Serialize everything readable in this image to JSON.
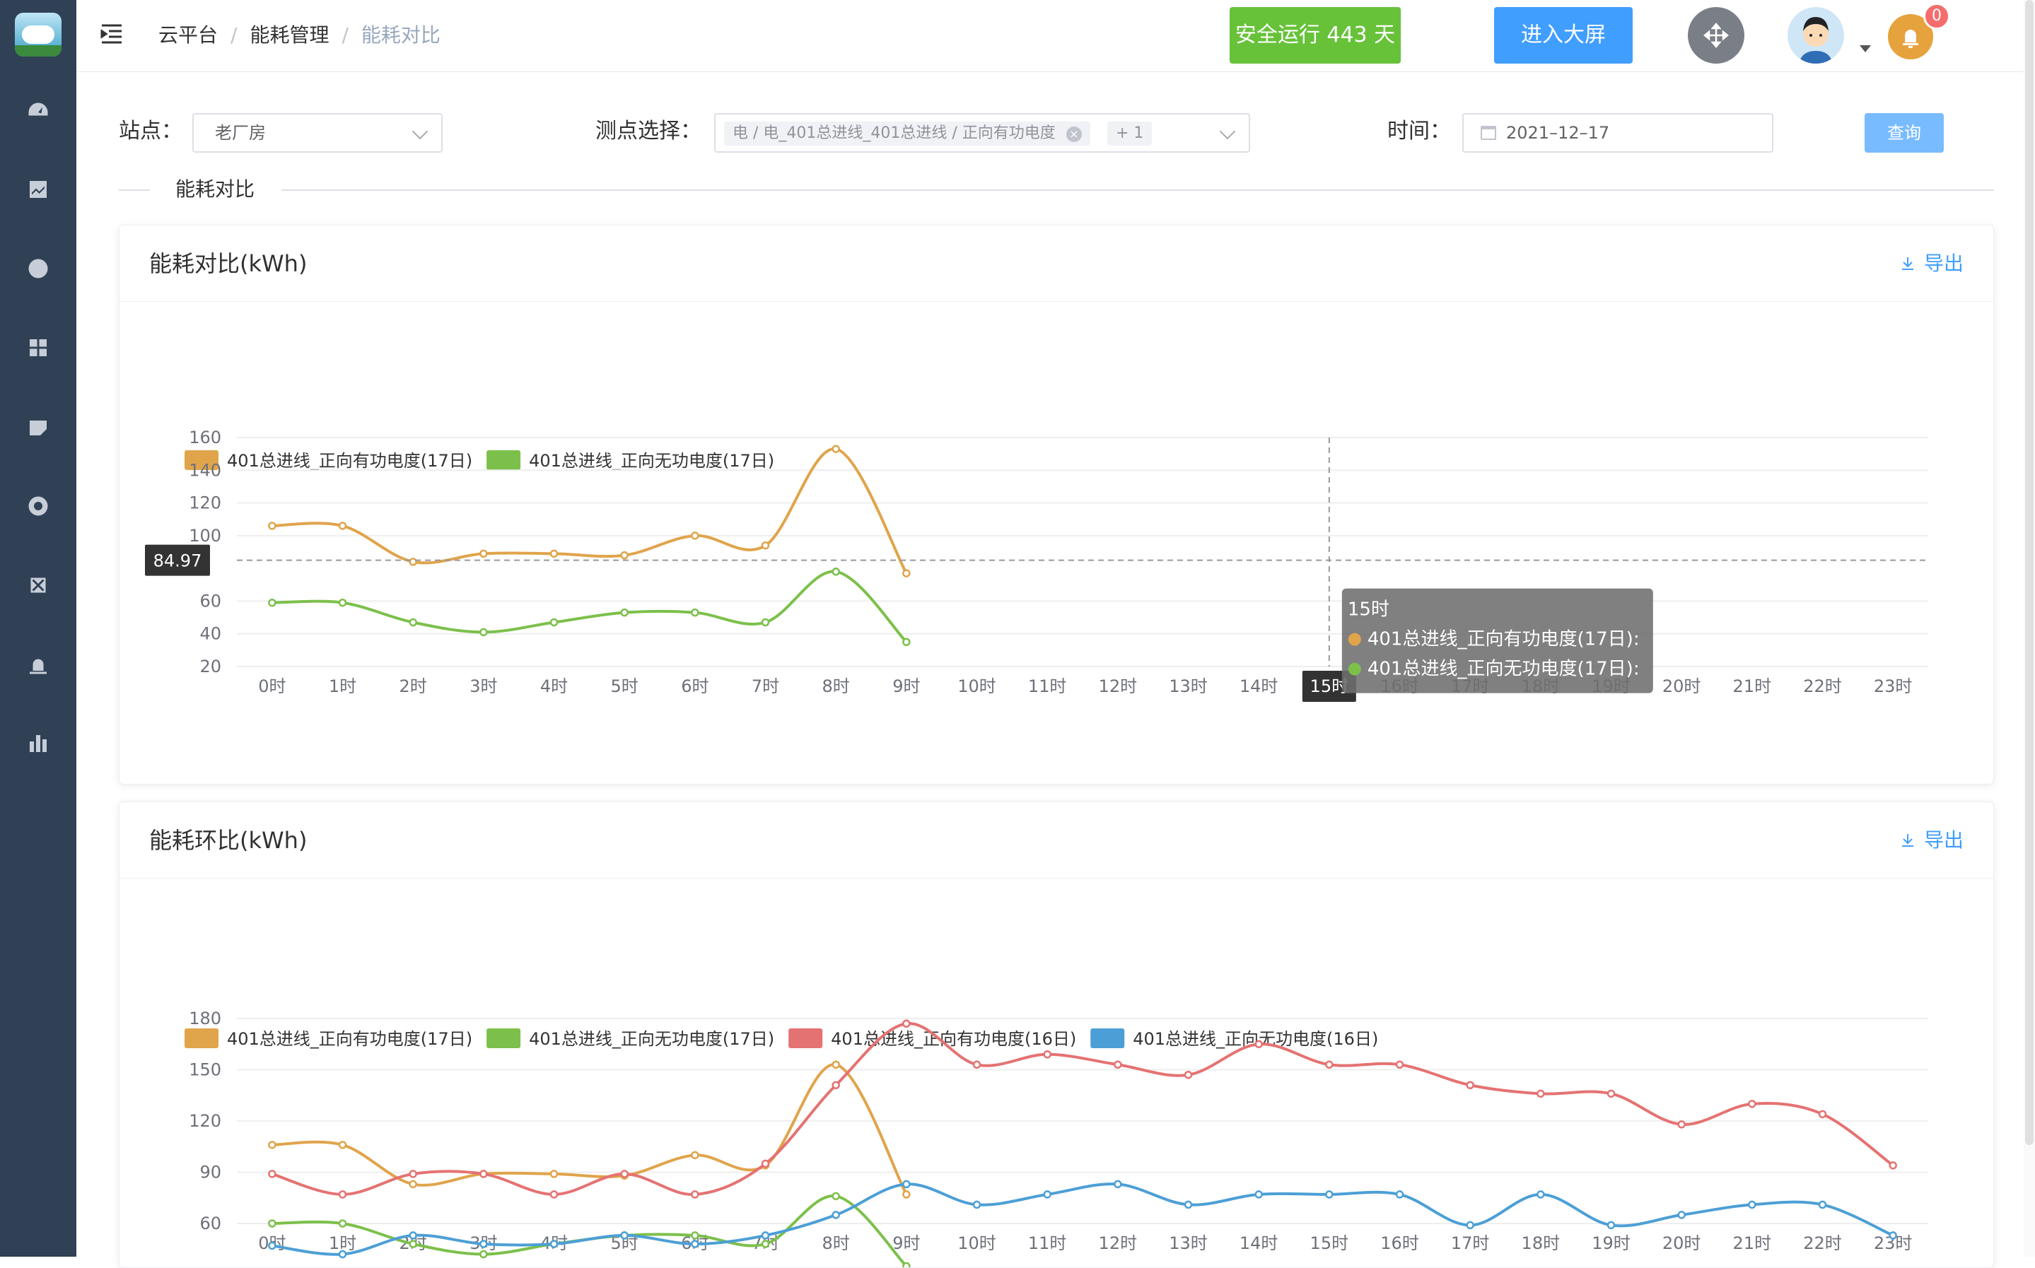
{
  "breadcrumb": [
    "云平台",
    "能耗管理",
    "能耗对比"
  ],
  "header": {
    "safe_run": "安全运行 443 天",
    "big_screen": "进入大屏",
    "notification_count": "0"
  },
  "sidebar": {
    "icons": [
      "dashboard-icon",
      "chart-icon",
      "globe-icon",
      "grid-icon",
      "leaf-icon",
      "lifebuoy-icon",
      "fault-icon",
      "alarm-icon",
      "bar-chart-icon"
    ]
  },
  "filters": {
    "site_label": "站点：",
    "site_value": "老厂房",
    "point_label": "测点选择：",
    "point_tag": "电 / 电_401总进线_401总进线 / 正向有功电度",
    "point_more": "+ 1",
    "time_label": "时间：",
    "time_value": "2021–12–17",
    "query": "查询"
  },
  "section_title": "能耗对比",
  "colors": {
    "orange": "#E0A44B",
    "green": "#7CC04B",
    "red": "#E57272",
    "blue": "#4C9FD6",
    "primary": "#409EFF",
    "sidebar": "#304156"
  },
  "charts": [
    {
      "title": "能耗对比(kWh)",
      "export": "导出",
      "chart_data": {
        "type": "line",
        "categories": [
          "0时",
          "1时",
          "2时",
          "3时",
          "4时",
          "5时",
          "6时",
          "7时",
          "8时",
          "9时",
          "10时",
          "11时",
          "12时",
          "13时",
          "14时",
          "15时",
          "16时",
          "17时",
          "18时",
          "19时",
          "20时",
          "21时",
          "22时",
          "23时"
        ],
        "yticks": [
          20,
          40,
          60,
          100,
          120,
          140,
          160
        ],
        "ylim": [
          20,
          160
        ],
        "series": [
          {
            "name": "401总进线_正向有功电度(17日)",
            "color": "#E0A44B",
            "values": [
              106,
              106,
              84,
              89,
              89,
              88,
              100,
              94,
              153,
              77
            ]
          },
          {
            "name": "401总进线_正向无功电度(17日)",
            "color": "#7CC04B",
            "values": [
              59,
              59,
              47,
              41,
              47,
              53,
              53,
              47,
              78,
              35
            ]
          }
        ],
        "crosshair": {
          "y_value": "84.97",
          "x_category": "15时",
          "x_index": 15
        },
        "tooltip": {
          "title": "15时",
          "rows": [
            "401总进线_正向有功电度(17日):",
            "401总进线_正向无功电度(17日):"
          ]
        }
      }
    },
    {
      "title": "能耗环比(kWh)",
      "export": "导出",
      "chart_data": {
        "type": "line",
        "categories": [
          "0时",
          "1时",
          "2时",
          "3时",
          "4时",
          "5时",
          "6时",
          "7时",
          "8时",
          "9时",
          "10时",
          "11时",
          "12时",
          "13时",
          "14时",
          "15时",
          "16时",
          "17时",
          "18时",
          "19时",
          "20时",
          "21时",
          "22时",
          "23时"
        ],
        "yticks": [
          60,
          90,
          120,
          150,
          180
        ],
        "ylim": [
          60,
          180
        ],
        "series": [
          {
            "name": "401总进线_正向有功电度(17日)",
            "color": "#E0A44B",
            "values": [
              106,
              106,
              83,
              89,
              89,
              88,
              100,
              94,
              153,
              77
            ]
          },
          {
            "name": "401总进线_正向无功电度(17日)",
            "color": "#7CC04B",
            "values": [
              60,
              60,
              48,
              42,
              48,
              53,
              53,
              48,
              76,
              35
            ]
          },
          {
            "name": "401总进线_正向有功电度(16日)",
            "color": "#E57272",
            "values": [
              89,
              77,
              89,
              89,
              77,
              89,
              77,
              95,
              141,
              177,
              153,
              159,
              153,
              147,
              165,
              153,
              153,
              141,
              136,
              136,
              118,
              130,
              124,
              94
            ]
          },
          {
            "name": "401总进线_正向无功电度(16日)",
            "color": "#4C9FD6",
            "values": [
              47,
              42,
              53,
              48,
              48,
              53,
              48,
              53,
              65,
              83,
              71,
              77,
              83,
              71,
              77,
              77,
              77,
              59,
              77,
              59,
              65,
              71,
              71,
              53
            ]
          }
        ]
      }
    }
  ]
}
